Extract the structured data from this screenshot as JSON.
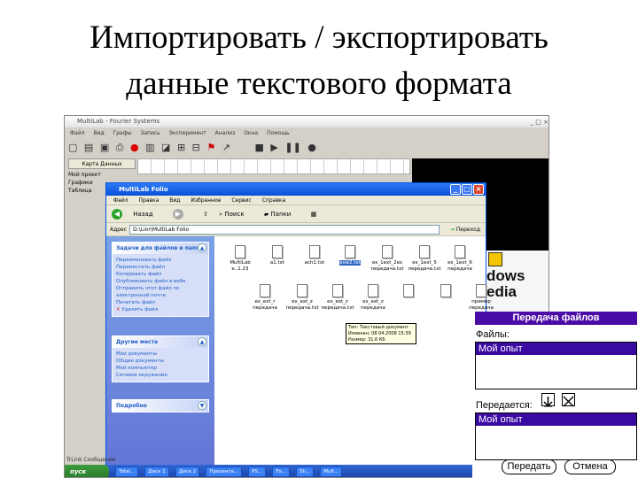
{
  "slide": {
    "title_line1": "Импортировать / экспортировать",
    "title_line2": "данные текстового формата"
  },
  "multilab": {
    "title": "MultiLab - Fourier Systems",
    "window_controls": "_ □ ×",
    "menu": [
      "Файл",
      "Вид",
      "Графы",
      "Запись",
      "Эксперимент",
      "Анализ",
      "Окна",
      "Помощь"
    ],
    "toolbar_icons": [
      "new-icon",
      "open-icon",
      "save-icon",
      "print-icon",
      "record-icon",
      "stop-icon",
      "play-icon",
      "pause-icon"
    ],
    "map_tab": "Карта Данных",
    "tree": [
      "Мой проект",
      "Графики",
      "Таблица"
    ],
    "status": "TrLink Сообщение"
  },
  "explorer": {
    "title": "MultiLab Folio",
    "menu": [
      "Файл",
      "Правка",
      "Вид",
      "Избранное",
      "Сервис",
      "Справка"
    ],
    "back": "Назад",
    "search": "Поиск",
    "folders": "Папки",
    "address_label": "Адрес",
    "address": "D:\\Lior\\MultiLab Folio",
    "go": "Переход",
    "tasks_title": "Задачи для файлов и папок",
    "tasks": [
      "Переименовать файл",
      "Переместить файл",
      "Копировать файл",
      "Опубликовать файл в вебе",
      "Отправить этот файл по электронной почте",
      "Печатать файл",
      "Удалить файл"
    ],
    "other_title": "Другие места",
    "other": [
      "Мои документы",
      "Общие документы",
      "Мой компьютер",
      "Сетевое окружение"
    ],
    "details_title": "Подробно",
    "files": [
      {
        "name": "MultiLab e..1.23",
        "sel": false
      },
      {
        "name": "a1.txt",
        "sel": false
      },
      {
        "name": "ach1.txt",
        "sel": false
      },
      {
        "name": "asw2.txt",
        "sel": true
      },
      {
        "name": "ex_1ext_2ex передача.txt",
        "sel": false
      },
      {
        "name": "ex_1ext_5 передача.txt",
        "sel": false
      },
      {
        "name": "ex_1ext_6 передача",
        "sel": false
      },
      {
        "name": "ex_ext_r передача",
        "sel": false
      },
      {
        "name": "ex_ext_z передача.txt",
        "sel": false
      },
      {
        "name": "ex_ext_z передача.txt",
        "sel": false
      },
      {
        "name": "ex_ext_z передача",
        "sel": false
      },
      {
        "name": "",
        "sel": false
      },
      {
        "name": "",
        "sel": false
      },
      {
        "name": "пример передача",
        "sel": false
      }
    ],
    "tooltip": "Тип: Текстовый документ Изменен: 08.04.2008 15:39 Размер: 31,6 КБ"
  },
  "media_logo_text": "dows edia",
  "taskbar": {
    "start": "пуск",
    "items": [
      "Total...",
      "Диск 1",
      "Диск 2",
      "Презента...",
      "PS...",
      "Fo...",
      "Sh...",
      "Mult..."
    ]
  },
  "transfer": {
    "header": "Передача файлов",
    "files_label": "Файлы:",
    "files_list": [
      "Мой опыт"
    ],
    "transferring_label": "Передается:",
    "transferring_list": [
      "Мой опыт"
    ],
    "send_label": "Передать",
    "cancel_label": "Отмена"
  },
  "colors": {
    "purple_header": "#4b0ba6",
    "xp_blue": "#0a4fd9",
    "selection": "#3a0aa3"
  }
}
